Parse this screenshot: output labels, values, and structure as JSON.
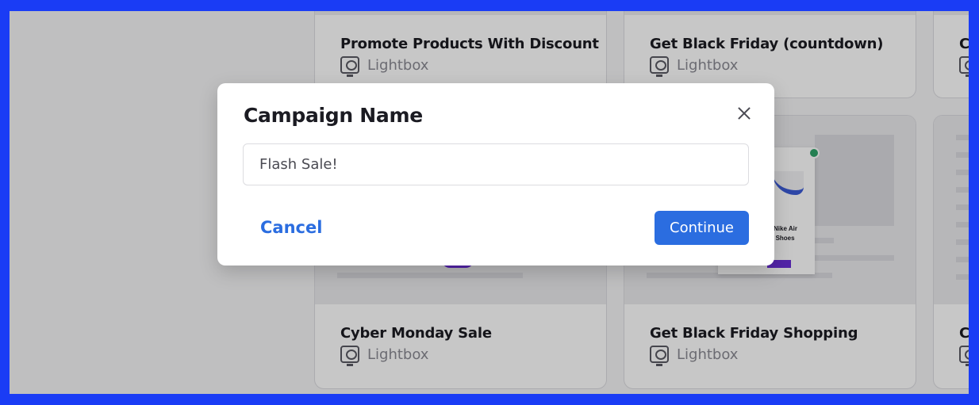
{
  "templates": [
    {
      "title": "Promote Products With Discount",
      "type": "Lightbox"
    },
    {
      "title": "Get Black Friday (countdown)",
      "type": "Lightbox"
    },
    {
      "title": "Cyber Monday Sale",
      "type": "Lightbox"
    },
    {
      "title": "Get Black Friday Shopping",
      "type": "Lightbox"
    },
    {
      "title": "C",
      "type": ""
    },
    {
      "title": "C",
      "type": ""
    }
  ],
  "preview": {
    "line1": "Nike Air",
    "line2": "'s Shoes"
  },
  "modal": {
    "title": "Campaign Name",
    "input_value": "Flash Sale!",
    "cancel_label": "Cancel",
    "continue_label": "Continue"
  },
  "colors": {
    "accent": "#2b6de0",
    "frame": "#1a3cf5",
    "badge": "#2fa36a",
    "promo": "#6a2fd6"
  }
}
